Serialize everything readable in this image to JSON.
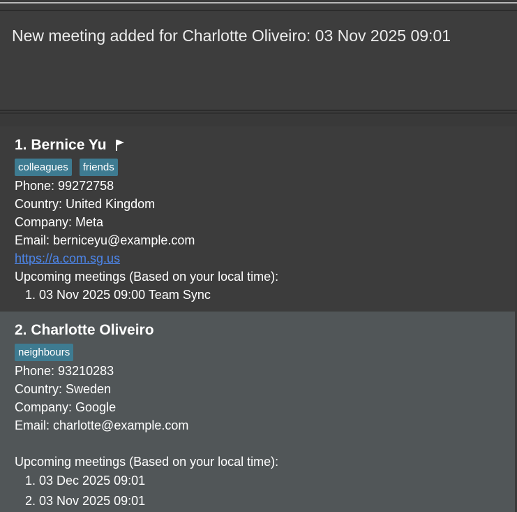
{
  "result": {
    "message": "New meeting added for Charlotte Oliveiro: 03 Nov 2025 09:01"
  },
  "persons": [
    {
      "index_name": "1. Bernice Yu",
      "flagged": true,
      "tags": [
        "colleagues",
        "friends"
      ],
      "phone": "Phone: 99272758",
      "country": "Country: United Kingdom",
      "company": "Company: Meta",
      "email": "Email: berniceyu@example.com",
      "website": "https://a.com.sg.us",
      "meetings_header": "Upcoming meetings (Based on your local time):",
      "meetings": [
        "1. 03 Nov 2025 09:00 Team Sync"
      ]
    },
    {
      "index_name": "2. Charlotte Oliveiro",
      "flagged": false,
      "tags": [
        "neighbours"
      ],
      "phone": "Phone: 93210283",
      "country": "Country: Sweden",
      "company": "Company: Google",
      "email": "Email: charlotte@example.com",
      "website": "",
      "meetings_header": "Upcoming meetings (Based on your local time):",
      "meetings": [
        "1. 03 Dec 2025 09:01",
        "2. 03 Nov 2025 09:01"
      ]
    }
  ],
  "colors": {
    "tag_bg": "#3e7b91",
    "link": "#4d86ea",
    "selected_card_bg": "#515658"
  },
  "icons": {
    "flag": "flag-icon"
  }
}
